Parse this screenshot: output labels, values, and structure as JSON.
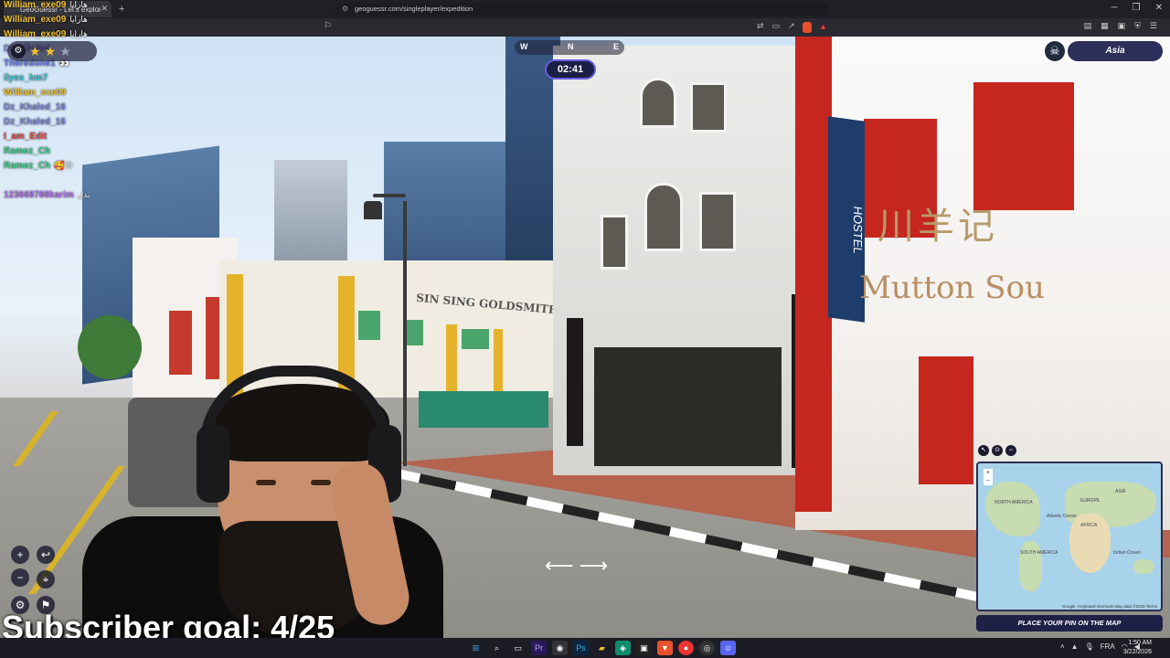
{
  "browser": {
    "tab_title": "GeoGuessr - Let's explore the world!",
    "url": "geoguessr.com/singleplayer/expedition",
    "new_tab_icon": "+",
    "window_controls": [
      "─",
      "❐",
      "✕"
    ]
  },
  "chat": [
    {
      "user": "William_exe09",
      "color": "#f0c12d",
      "msg": "هارايا"
    },
    {
      "user": "William_exe09",
      "color": "#f0c12d",
      "msg": "هارايا"
    },
    {
      "user": "William_exe09",
      "color": "#f0c12d",
      "msg": "هارايا"
    },
    {
      "user": "Dz_Khaled",
      "color": "#7d86d8",
      "msg": ""
    },
    {
      "user": "Theredone1",
      "color": "#6a7ee8",
      "msg": "👀"
    },
    {
      "user": "ilyes_hm7",
      "color": "#3fc6d8",
      "msg": ""
    },
    {
      "user": "William_exe09",
      "color": "#f0c12d",
      "msg": ""
    },
    {
      "user": "Dz_Khaled_16",
      "color": "#7d86d8",
      "msg": ""
    },
    {
      "user": "Dz_Khaled_16",
      "color": "#7d86d8",
      "msg": ""
    },
    {
      "user": "I_am_Edit",
      "color": "#e04a4a",
      "msg": ""
    },
    {
      "user": "Ramez_Ch",
      "color": "#3fd08a",
      "msg": ""
    },
    {
      "user": "Ramez_Ch",
      "color": "#3fd08a",
      "msg": "🥰😍"
    },
    {
      "user": "",
      "color": "#e04a4a",
      "msg": ""
    },
    {
      "user": "123668788karim",
      "color": "#b070e8",
      "msg": "بدل"
    }
  ],
  "game": {
    "timer": "02:41",
    "region": "Asia",
    "stars_filled": 2,
    "stars_total": 3,
    "compass_marks": [
      "W",
      "N",
      "E"
    ],
    "place_pin_label": "PLACE YOUR PIN ON THE MAP",
    "map_labels": [
      "NORTH AMERICA",
      "EUROPE",
      "ASIA",
      "AFRICA",
      "SOUTH AMERICA",
      "Indian Ocean",
      "Atlantic Ocean"
    ],
    "map_attribution": "Keyboard shortcuts   Map data ©2026   Terms",
    "map_kb": "Google"
  },
  "scene_signs": {
    "goldsmiths": "SIN SING GOLDSMITHS",
    "hostel": "HOSTEL",
    "mutton": "Mutton Sou",
    "chinese_banner": "川羊记"
  },
  "overlay": {
    "subscriber_goal": "Subscriber goal: 4/25"
  },
  "taskbar": {
    "lang": "FRA",
    "time": "1:50 AM",
    "date": "3/22/2026"
  },
  "colors": {
    "timer_border": "#6a5be0",
    "region_pill": "#2c2f5a",
    "map_water": "#a8d3ea"
  }
}
